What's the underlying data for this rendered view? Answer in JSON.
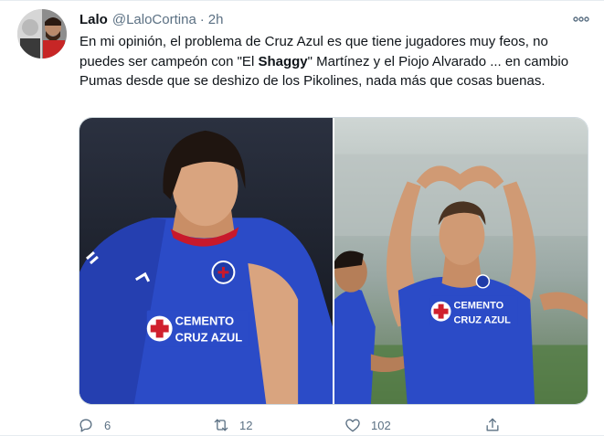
{
  "tweet": {
    "author_name": "Lalo",
    "author_handle": "@LaloCortina",
    "separator": "·",
    "time": "2h",
    "text_part1": "En mi opinión, el problema de Cruz Azul es que tiene jugadores muy feos, no puedes ser campeón con \"El ",
    "text_bold": "Shaggy",
    "text_part2": "\"  Martínez y el Piojo Alvarado ... en cambio Pumas desde que se deshizo de los Pikolines, nada más que cosas buenas.",
    "media": [
      {
        "sponsor_line1": "CEMENTO",
        "sponsor_line2": "CRUZ AZUL"
      },
      {
        "sponsor_line1": "CEMENTO",
        "sponsor_line2": "CRUZ AZUL"
      }
    ]
  },
  "actions": {
    "replies": "6",
    "retweets": "12",
    "likes": "102"
  },
  "icons": {
    "more": "more-horizontal-icon",
    "reply": "reply-icon",
    "retweet": "retweet-icon",
    "like": "heart-icon",
    "share": "share-icon"
  },
  "colors": {
    "secondary_text": "#5b7083",
    "jersey_blue": "#2b4bc7",
    "sponsor_red": "#d0202e"
  }
}
